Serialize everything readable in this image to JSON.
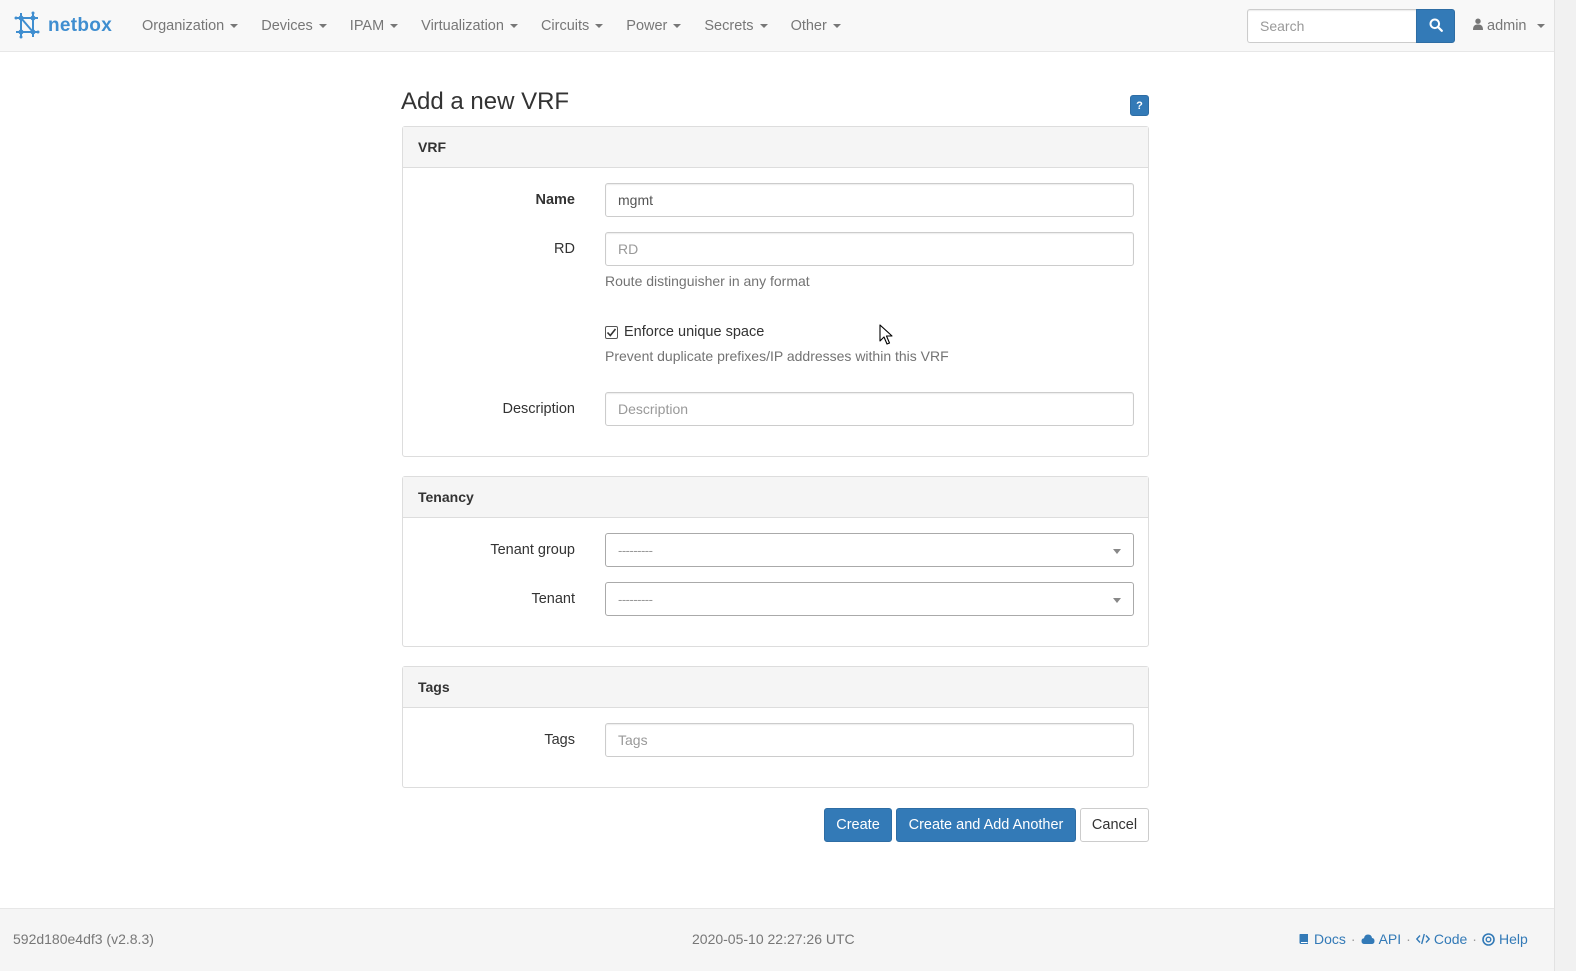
{
  "navbar": {
    "brand": "netbox",
    "menu": [
      {
        "label": "Organization"
      },
      {
        "label": "Devices"
      },
      {
        "label": "IPAM"
      },
      {
        "label": "Virtualization"
      },
      {
        "label": "Circuits"
      },
      {
        "label": "Power"
      },
      {
        "label": "Secrets"
      },
      {
        "label": "Other"
      }
    ],
    "search_placeholder": "Search",
    "user": "admin"
  },
  "page": {
    "title": "Add a new VRF",
    "help_label": "?"
  },
  "vrf_panel": {
    "heading": "VRF",
    "name_label": "Name",
    "name_value": "mgmt",
    "rd_label": "RD",
    "rd_placeholder": "RD",
    "rd_help": "Route distinguisher in any format",
    "enforce_label": "Enforce unique space",
    "enforce_checked": true,
    "enforce_help": "Prevent duplicate prefixes/IP addresses within this VRF",
    "description_label": "Description",
    "description_placeholder": "Description"
  },
  "tenancy_panel": {
    "heading": "Tenancy",
    "tenant_group_label": "Tenant group",
    "tenant_group_value": "---------",
    "tenant_label": "Tenant",
    "tenant_value": "---------"
  },
  "tags_panel": {
    "heading": "Tags",
    "tags_label": "Tags",
    "tags_placeholder": "Tags"
  },
  "actions": {
    "create": "Create",
    "create_another": "Create and Add Another",
    "cancel": "Cancel"
  },
  "footer": {
    "version": "592d180e4df3 (v2.8.3)",
    "timestamp": "2020-05-10 22:27:26 UTC",
    "links": {
      "docs": "Docs",
      "api": "API",
      "code": "Code",
      "help": "Help"
    },
    "separator": "·"
  },
  "colors": {
    "primary": "#337ab7",
    "brand": "#3f8ed0",
    "navbar_bg": "#f8f8f8"
  }
}
